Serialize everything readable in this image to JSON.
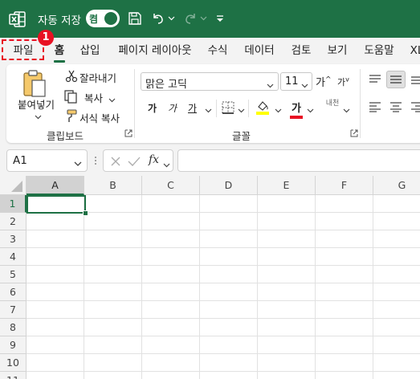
{
  "titlebar": {
    "autosave_label": "자동 저장",
    "autosave_toggle": "켬"
  },
  "tabs": [
    {
      "label": "파일"
    },
    {
      "label": "홈"
    },
    {
      "label": "삽입"
    },
    {
      "label": "페이지 레이아웃"
    },
    {
      "label": "수식"
    },
    {
      "label": "데이터"
    },
    {
      "label": "검토"
    },
    {
      "label": "보기"
    },
    {
      "label": "도움말"
    },
    {
      "label": "XL"
    }
  ],
  "badge": "1",
  "clipboard": {
    "paste_label": "붙여넣기",
    "cut_label": "잘라내기",
    "copy_label": "복사",
    "format_painter_label": "서식 복사",
    "group_label": "클립보드"
  },
  "font": {
    "font_name": "맑은 고딕",
    "font_size": "11",
    "increase_size_glyph": "가",
    "decrease_size_glyph": "가",
    "bold_glyph": "가",
    "italic_glyph": "가",
    "underline_glyph": "가",
    "font_color_glyph": "가",
    "phonetic_glyph": "내천",
    "group_label": "글꼴"
  },
  "formula_bar": {
    "name_box": "A1",
    "fx": "fx",
    "formula": ""
  },
  "grid": {
    "columns": [
      "A",
      "B",
      "C",
      "D",
      "E",
      "F",
      "G"
    ],
    "rows": [
      "1",
      "2",
      "3",
      "4",
      "5",
      "6",
      "7",
      "8",
      "9",
      "10",
      "11"
    ],
    "active_cell": "A1"
  },
  "colors": {
    "accent": "#1e7145",
    "highlight": "#e81123",
    "fill_yellow": "#ffff00",
    "font_red": "#e81123"
  }
}
